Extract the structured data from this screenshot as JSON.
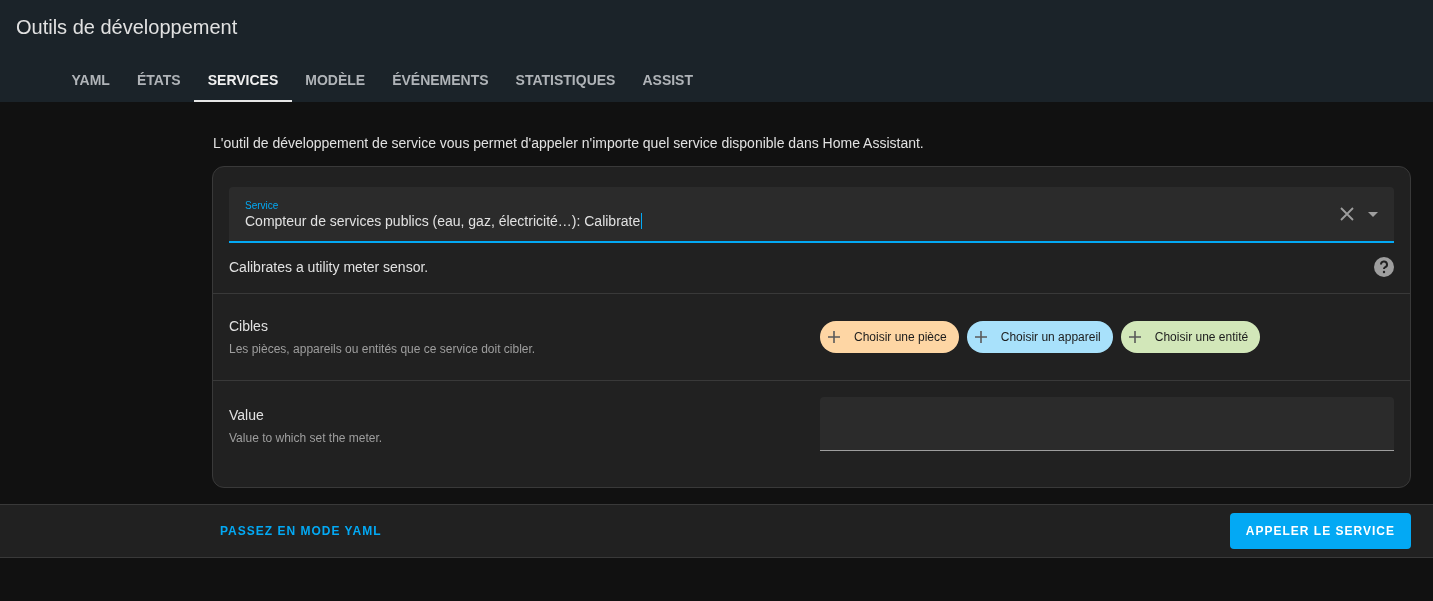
{
  "header": {
    "title": "Outils de développement"
  },
  "tabs": [
    {
      "label": "YAML",
      "selected": false
    },
    {
      "label": "ÉTATS",
      "selected": false
    },
    {
      "label": "SERVICES",
      "selected": true
    },
    {
      "label": "MODÈLE",
      "selected": false
    },
    {
      "label": "ÉVÉNEMENTS",
      "selected": false
    },
    {
      "label": "STATISTIQUES",
      "selected": false
    },
    {
      "label": "ASSIST",
      "selected": false
    }
  ],
  "intro": "L'outil de développement de service vous permet d'appeler n'importe quel service disponible dans Home Assistant.",
  "service_field": {
    "label": "Service",
    "value": "Compteur de services publics (eau, gaz, électricité…): Calibrate"
  },
  "service_description": "Calibrates a utility meter sensor.",
  "targets": {
    "title": "Cibles",
    "description": "Les pièces, appareils ou entités que ce service doit cibler.",
    "chips": [
      {
        "label": "Choisir une pièce",
        "color": "#fed6a4"
      },
      {
        "label": "Choisir un appareil",
        "color": "#a8e1fb"
      },
      {
        "label": "Choisir une entité",
        "color": "#d2e7b9"
      }
    ]
  },
  "value_field": {
    "title": "Value",
    "description": "Value to which set the meter."
  },
  "footer": {
    "yaml_link": "PASSEZ EN MODE YAML",
    "call_button": "APPELER LE SERVICE"
  }
}
